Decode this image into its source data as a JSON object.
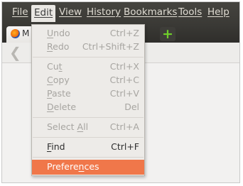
{
  "menubar": {
    "file": {
      "pre": "",
      "key": "F",
      "post": "ile"
    },
    "edit": {
      "pre": "",
      "key": "E",
      "post": "dit"
    },
    "view": {
      "pre": "",
      "key": "V",
      "post": "iew"
    },
    "history": {
      "pre": "Hi",
      "key": "s",
      "post": "tory"
    },
    "bookmarks": {
      "pre": "",
      "key": "B",
      "post": "ookmarks"
    },
    "tools": {
      "pre": "",
      "key": "T",
      "post": "ools"
    },
    "help": {
      "pre": "",
      "key": "H",
      "post": "elp"
    }
  },
  "tab": {
    "title": "M"
  },
  "newtab": {
    "glyph": "+"
  },
  "toolbar": {
    "back_glyph": "❮"
  },
  "edit_menu": {
    "undo": {
      "pre": "",
      "key": "U",
      "post": "ndo",
      "accel": "Ctrl+Z",
      "enabled": false
    },
    "redo": {
      "pre": "",
      "key": "R",
      "post": "edo",
      "accel": "Ctrl+Shift+Z",
      "enabled": false
    },
    "cut": {
      "pre": "Cu",
      "key": "t",
      "post": "",
      "accel": "Ctrl+X",
      "enabled": false
    },
    "copy": {
      "pre": "",
      "key": "C",
      "post": "opy",
      "accel": "Ctrl+C",
      "enabled": false
    },
    "paste": {
      "pre": "",
      "key": "P",
      "post": "aste",
      "accel": "Ctrl+V",
      "enabled": false
    },
    "delete": {
      "pre": "",
      "key": "D",
      "post": "elete",
      "accel": "Del",
      "enabled": false
    },
    "select_all": {
      "pre": "Select ",
      "key": "A",
      "post": "ll",
      "accel": "Ctrl+A",
      "enabled": false
    },
    "find": {
      "pre": "",
      "key": "F",
      "post": "ind",
      "accel": "Ctrl+F",
      "enabled": true
    },
    "preferences": {
      "pre": "Prefere",
      "key": "n",
      "post": "ces",
      "accel": "",
      "enabled": true,
      "highlighted": true
    }
  },
  "colors": {
    "menubar_bg": "#3c3b37",
    "highlight": "#f0774a",
    "newtab_plus": "#6fcf2a"
  }
}
